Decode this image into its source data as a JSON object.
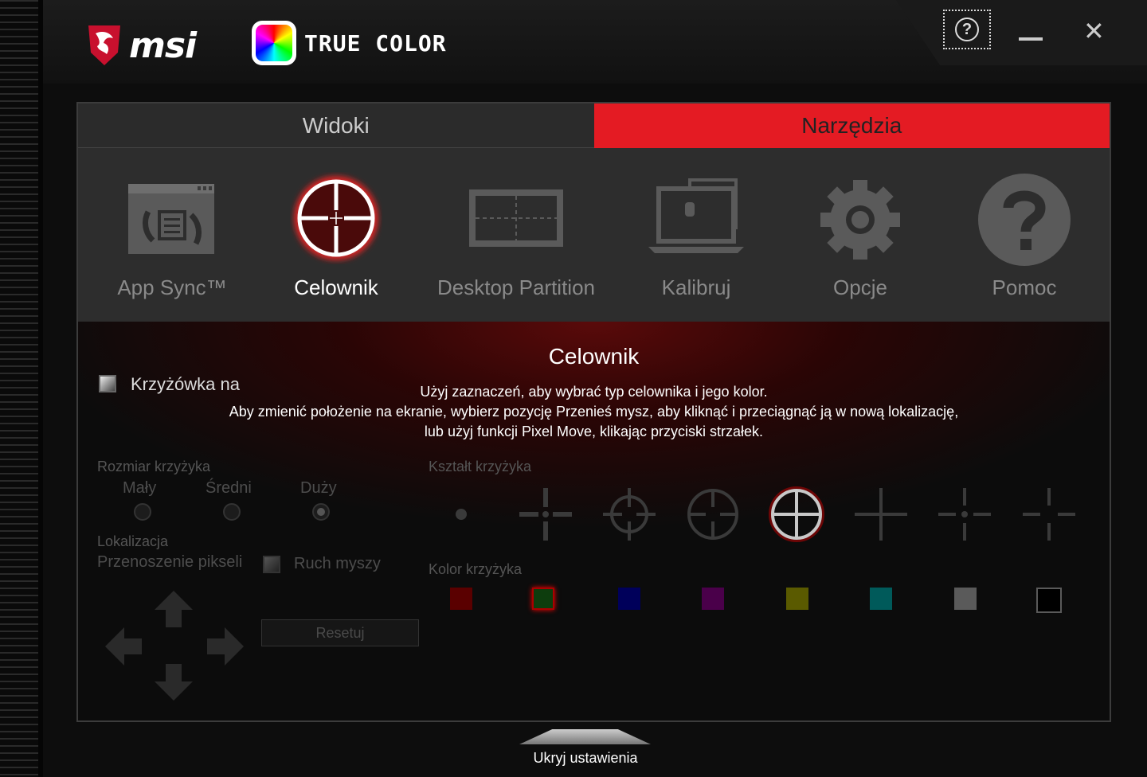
{
  "header": {
    "brand": "msi",
    "product": "TRUE COLOR"
  },
  "window_controls": {
    "help": "?",
    "close": "✕"
  },
  "tabs": [
    {
      "label": "Widoki",
      "active": false
    },
    {
      "label": "Narzędzia",
      "active": true
    }
  ],
  "tools": [
    {
      "label": "App Sync™",
      "icon": "app-sync-icon"
    },
    {
      "label": "Celownik",
      "icon": "crosshair-icon",
      "active": true
    },
    {
      "label": "Desktop Partition",
      "icon": "desktop-partition-icon"
    },
    {
      "label": "Kalibruj",
      "icon": "calibrate-icon"
    },
    {
      "label": "Opcje",
      "icon": "gear-icon"
    },
    {
      "label": "Pomoc",
      "icon": "help-icon"
    }
  ],
  "content": {
    "title": "Celownik",
    "desc1": "Użyj zaznaczeń, aby wybrać typ celownika i jego kolor.",
    "desc2": "Aby zmienić położenie na ekranie, wybierz pozycję Przenieś mysz, aby kliknąć i przeciągnąć ją w nową lokalizację,",
    "desc3": "lub użyj funkcji Pixel Move, klikając przyciski strzałek.",
    "toggle_label": "Krzyżówka na",
    "size_label": "Rozmiar krzyżyka",
    "sizes": [
      {
        "label": "Mały"
      },
      {
        "label": "Średni"
      },
      {
        "label": "Duży",
        "selected": true
      }
    ],
    "location_label": "Lokalizacja",
    "pixel_move_label": "Przenoszenie pikseli",
    "mouse_move_label": "Ruch myszy",
    "reset_label": "Resetuj",
    "shape_label": "Kształt krzyżyka",
    "selected_shape_index": 4,
    "color_label": "Kolor krzyżyka",
    "colors": [
      "#5a0000",
      "#0d3d0d",
      "#00005a",
      "#4a004a",
      "#5a5a00",
      "#005a5a",
      "#5a5a5a",
      "#000000"
    ],
    "selected_color_index": 1
  },
  "footer": {
    "hide_label": "Ukryj ustawienia"
  }
}
